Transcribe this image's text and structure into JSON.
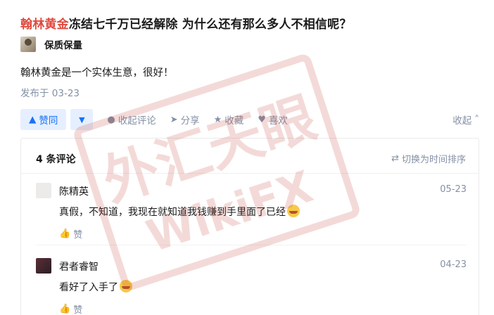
{
  "question": {
    "title_highlight": "翰林黄金",
    "title_rest": "冻结七千万已经解除 为什么还有那么多人不相信呢？"
  },
  "answer": {
    "author_name": "保质保量",
    "text": "翰林黄金是一个实体生意，很好！",
    "publish_time": "发布于 03-23"
  },
  "actions": {
    "vote_up_label": "赞同",
    "comment_label": "收起评论",
    "share_label": "分享",
    "collect_label": "收藏",
    "like_label": "喜欢",
    "collapse_label": "收起"
  },
  "comments": {
    "count_label": "4 条评论",
    "sort_label": "切换为时间排序",
    "items": [
      {
        "author": "陈精英",
        "date": "05-23",
        "text": "真假，不知道，我现在就知道我钱赚到手里面了已经",
        "like_label": "赞"
      },
      {
        "author": "君者睿智",
        "date": "04-23",
        "text": "看好了入手了",
        "like_label": "赞"
      }
    ]
  },
  "watermark": {
    "text_cn": "外汇天眼",
    "text_en": "WikiFX"
  },
  "colors": {
    "accent_blue": "#1772f6",
    "highlight_red": "#e04a3f",
    "muted_gray": "#8590a6",
    "watermark_red": "#c0392b"
  }
}
